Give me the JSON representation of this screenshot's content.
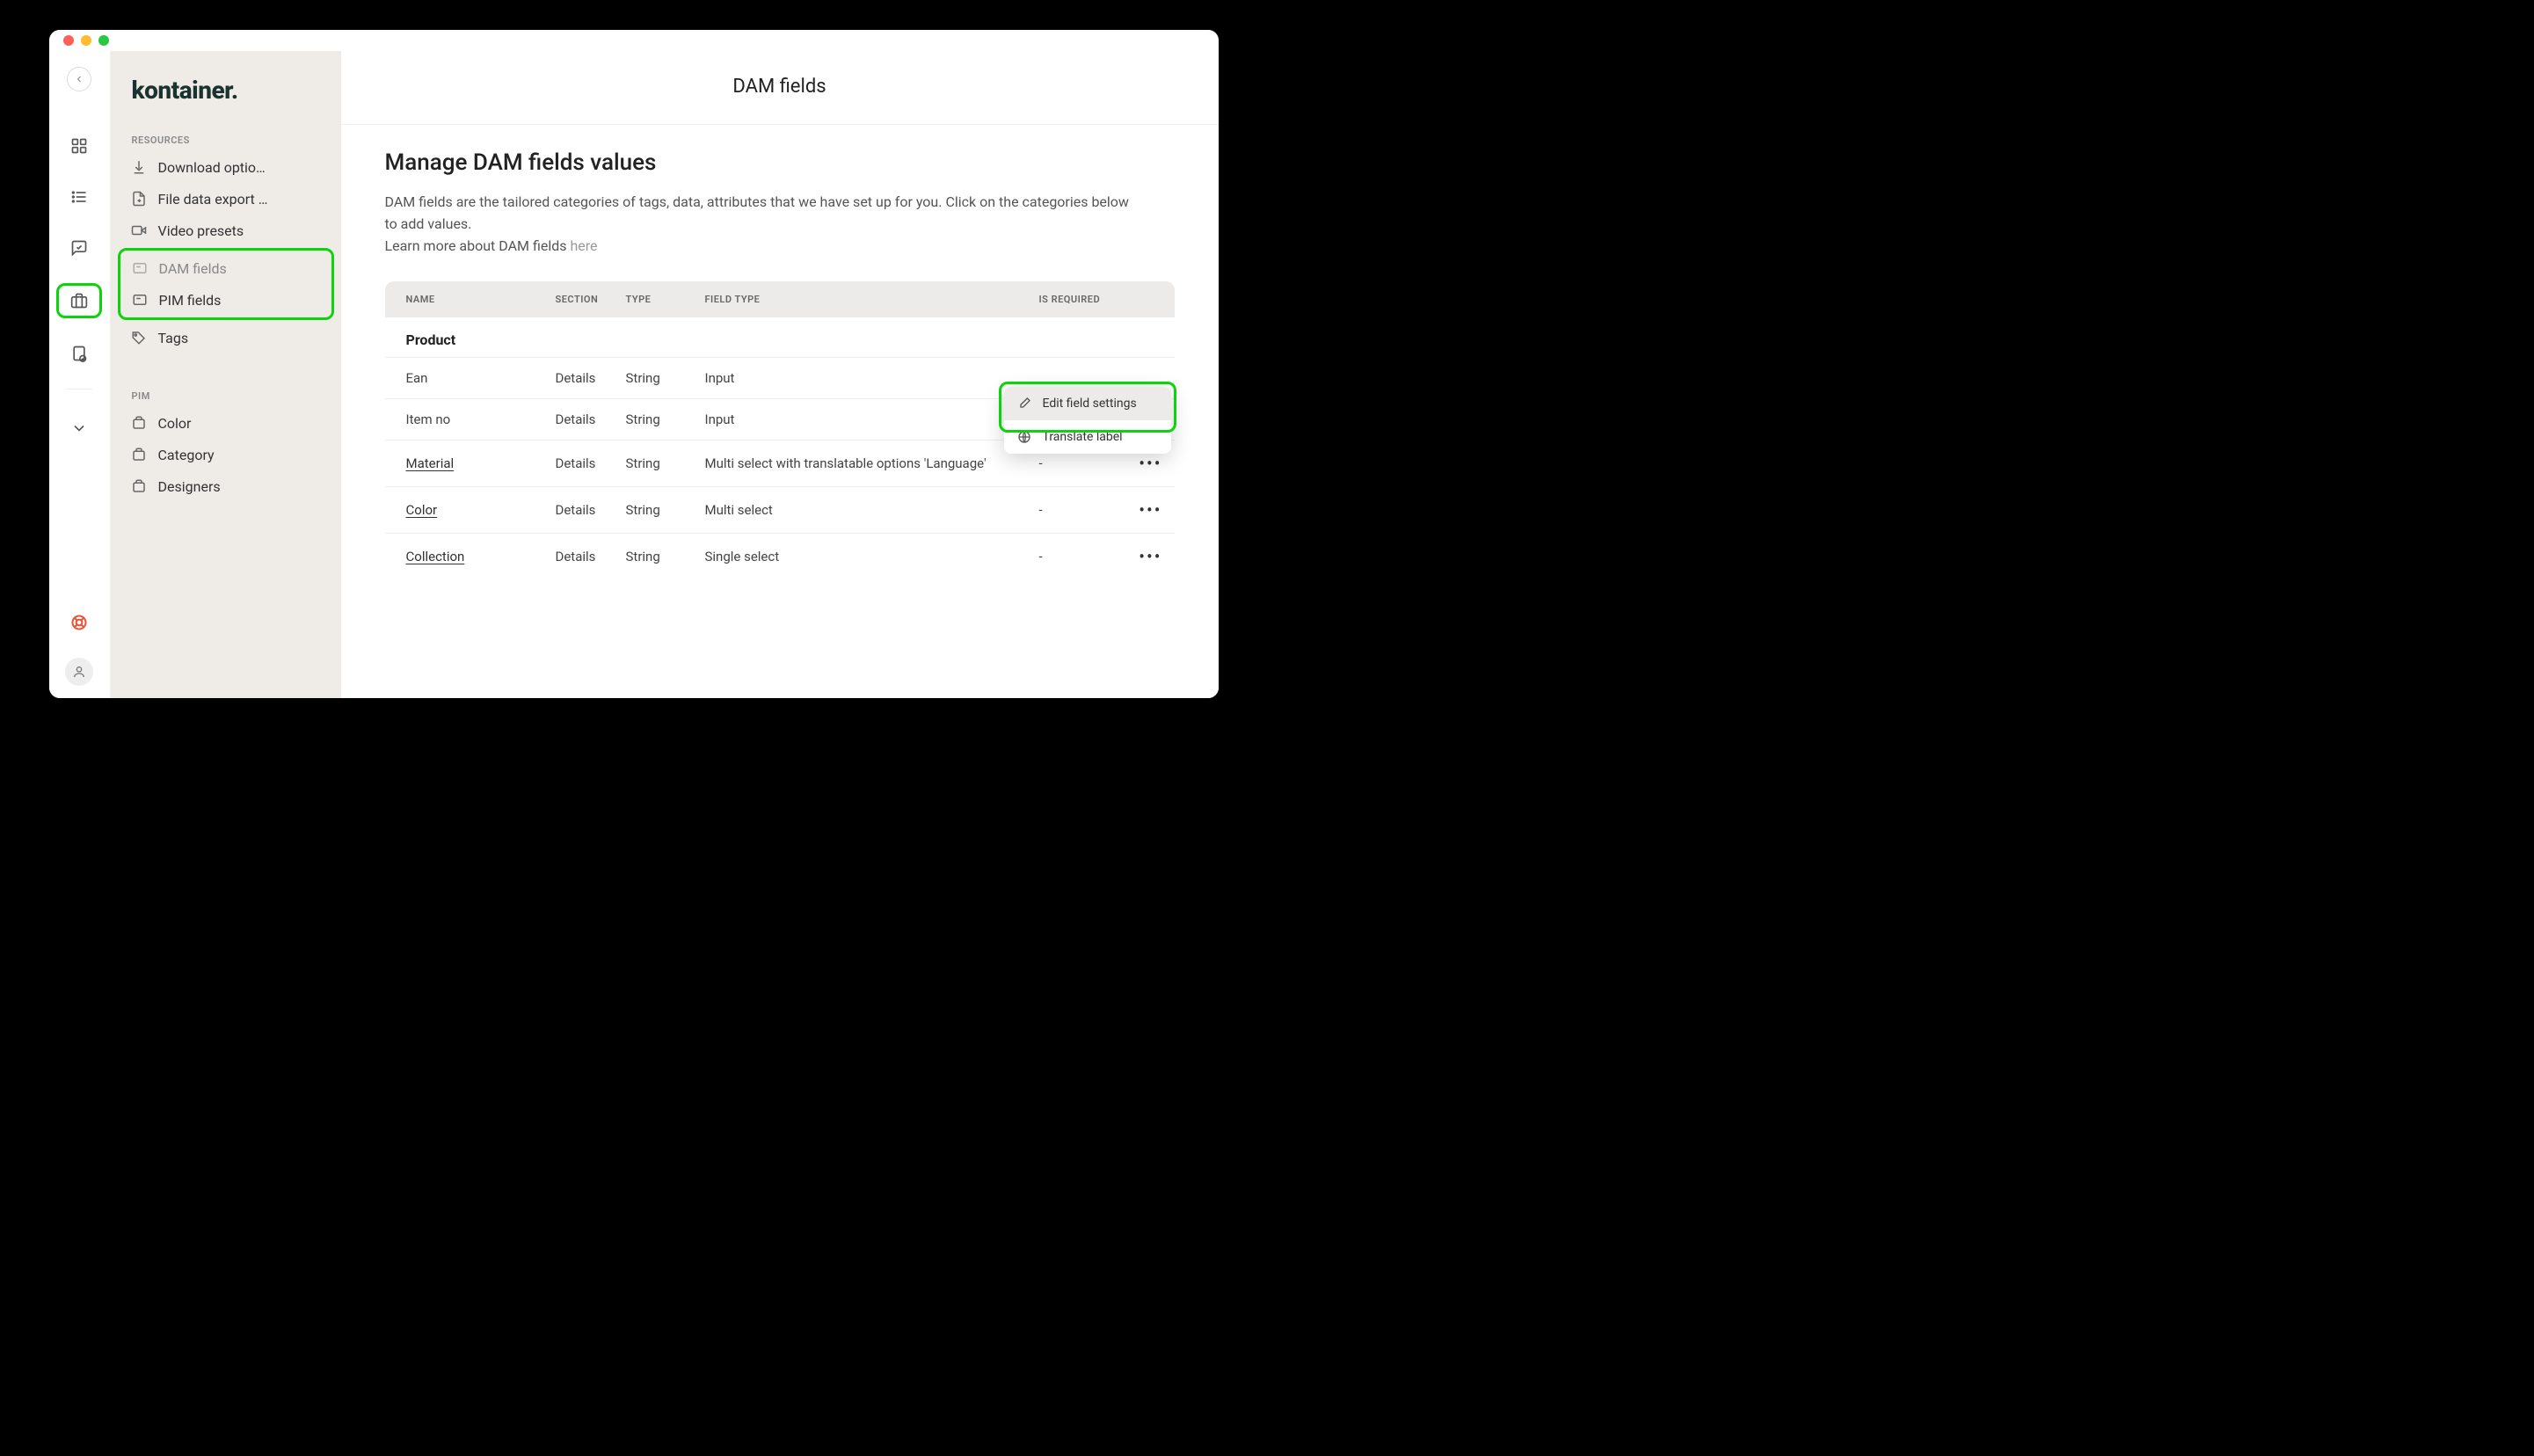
{
  "logo": "kontainer.",
  "header_title": "DAM fields",
  "sidebar": {
    "sections": {
      "resources": {
        "label": "RESOURCES",
        "items": [
          "Download optio…",
          "File data export …",
          "Video presets",
          "DAM fields",
          "PIM fields",
          "Tags"
        ]
      },
      "pim": {
        "label": "PIM",
        "items": [
          "Color",
          "Category",
          "Designers"
        ]
      }
    }
  },
  "content": {
    "heading": "Manage DAM fields values",
    "body": "DAM fields are the tailored categories of tags, data, attributes that we have set up for you. Click on the categories below to add values.",
    "learn_prefix": "Learn more about DAM fields ",
    "learn_link": "here"
  },
  "table": {
    "columns": [
      "NAME",
      "SECTION",
      "TYPE",
      "FIELD TYPE",
      "IS REQUIRED"
    ],
    "group": "Product",
    "rows": [
      {
        "name": "Ean",
        "underline": false,
        "section": "Details",
        "type": "String",
        "field_type": "Input",
        "required": ""
      },
      {
        "name": "Item no",
        "underline": false,
        "section": "Details",
        "type": "String",
        "field_type": "Input",
        "required": ""
      },
      {
        "name": "Material",
        "underline": true,
        "section": "Details",
        "type": "String",
        "field_type": "Multi select with translatable options 'Language'",
        "required": "-"
      },
      {
        "name": "Color",
        "underline": true,
        "section": "Details",
        "type": "String",
        "field_type": "Multi select",
        "required": "-"
      },
      {
        "name": "Collection",
        "underline": true,
        "section": "Details",
        "type": "String",
        "field_type": "Single select",
        "required": "-"
      }
    ]
  },
  "popover": {
    "edit": "Edit field settings",
    "translate": "Translate label"
  }
}
